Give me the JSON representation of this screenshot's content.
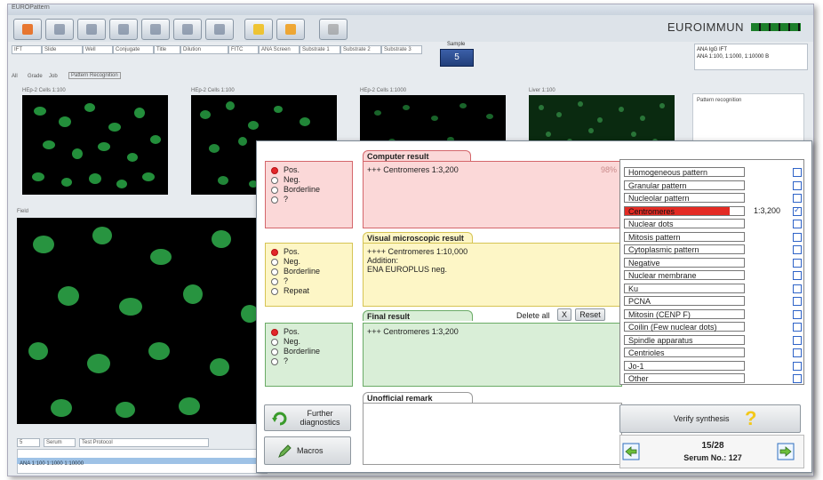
{
  "app": {
    "window_title": "EUROPattern",
    "brand": "EUROIMMUN"
  },
  "toolbar": {
    "icons": [
      "home-icon",
      "scan-icon",
      "scan-icon",
      "scan-icon",
      "scan-icon",
      "scan-icon",
      "scan-icon",
      "bulb-icon",
      "arrow-icon",
      "pause-icon"
    ]
  },
  "topfields": [
    "IFT",
    "Slide",
    "Well",
    "Conjugate",
    "Title",
    "Dilution",
    "FITC",
    "ANA Screen",
    "Substrate 1",
    "Substrate 2",
    "Substrate 3"
  ],
  "counter": {
    "label": "Sample",
    "value": "5"
  },
  "assay_info": {
    "line1": "ANA IgG IFT",
    "line2": "ANA 1:100, 1:1000, 1:10000 B"
  },
  "viewtabs": [
    "All",
    "Grade",
    "Job",
    "Pattern Recognition"
  ],
  "thumbs": [
    {
      "label": "HEp-2 Cells 1:100"
    },
    {
      "label": "HEp-2 Cells 1:100"
    },
    {
      "label": "HEp-2 Cells 1:1000"
    },
    {
      "label": "Liver 1:100"
    }
  ],
  "big_image_label": "Field",
  "pattern_recognition_label": "Pattern recognition",
  "bottom": {
    "field1": "5",
    "field2": "Serum",
    "field3": "Test Protocol",
    "table_row": "ANA 1:100 1:1000 1:10000"
  },
  "dialog": {
    "computer": {
      "tab": "Computer result",
      "options": [
        {
          "label": "Pos.",
          "on": true
        },
        {
          "label": "Neg.",
          "on": false
        },
        {
          "label": "Borderline",
          "on": false
        },
        {
          "label": "?",
          "on": false
        }
      ],
      "text": "+++ Centromeres 1:3,200",
      "confidence": "98%"
    },
    "visual": {
      "tab": "Visual microscopic result",
      "options": [
        {
          "label": "Pos.",
          "on": true
        },
        {
          "label": "Neg.",
          "on": false
        },
        {
          "label": "Borderline",
          "on": false
        },
        {
          "label": "?",
          "on": false
        },
        {
          "label": "Repeat",
          "on": false
        }
      ],
      "text": "++++ Centromeres 1:10,000\nAddition:\nENA EUROPLUS neg."
    },
    "final": {
      "tab": "Final result",
      "options": [
        {
          "label": "Pos.",
          "on": true
        },
        {
          "label": "Neg.",
          "on": false
        },
        {
          "label": "Borderline",
          "on": false
        },
        {
          "label": "?",
          "on": false
        }
      ],
      "text": "+++ Centromeres 1:3,200",
      "delete_all": "Delete all",
      "x_label": "X",
      "reset_label": "Reset"
    },
    "remark": {
      "tab": "Unofficial remark",
      "text": ""
    },
    "buttons": {
      "further": "Further\ndiagnostics",
      "macros": "Macros",
      "verify": "Verify synthesis"
    },
    "patterns": [
      {
        "name": "Homogeneous pattern",
        "checked": false,
        "titer": ""
      },
      {
        "name": "Granular pattern",
        "checked": false,
        "titer": ""
      },
      {
        "name": "Nucleolar pattern",
        "checked": false,
        "titer": ""
      },
      {
        "name": "Centromeres",
        "checked": true,
        "titer": "1:3,200",
        "selected": true
      },
      {
        "name": "Nuclear dots",
        "checked": false,
        "titer": ""
      },
      {
        "name": "Mitosis pattern",
        "checked": false,
        "titer": ""
      },
      {
        "name": "Cytoplasmic pattern",
        "checked": false,
        "titer": ""
      },
      {
        "name": "Negative",
        "checked": false,
        "titer": ""
      },
      {
        "name": "Nuclear membrane",
        "checked": false,
        "titer": ""
      },
      {
        "name": "Ku",
        "checked": false,
        "titer": ""
      },
      {
        "name": "PCNA",
        "checked": false,
        "titer": ""
      },
      {
        "name": "Mitosin (CENP F)",
        "checked": false,
        "titer": ""
      },
      {
        "name": "Coilin (Few nuclear dots)",
        "checked": false,
        "titer": ""
      },
      {
        "name": "Spindle apparatus",
        "checked": false,
        "titer": ""
      },
      {
        "name": "Centrioles",
        "checked": false,
        "titer": ""
      },
      {
        "name": "Jo-1",
        "checked": false,
        "titer": ""
      },
      {
        "name": "Other",
        "checked": false,
        "titer": ""
      }
    ],
    "nav": {
      "count": "15/28",
      "serum": "Serum No.: 127"
    }
  },
  "colors": {
    "red_bg": "#fbd8d8",
    "red_border": "#d4666b",
    "yellow_bg": "#fdf6c6",
    "yellow_border": "#d6c454",
    "green_bg": "#d9eed7",
    "green_border": "#6aab66",
    "selected": "#e32b24"
  }
}
